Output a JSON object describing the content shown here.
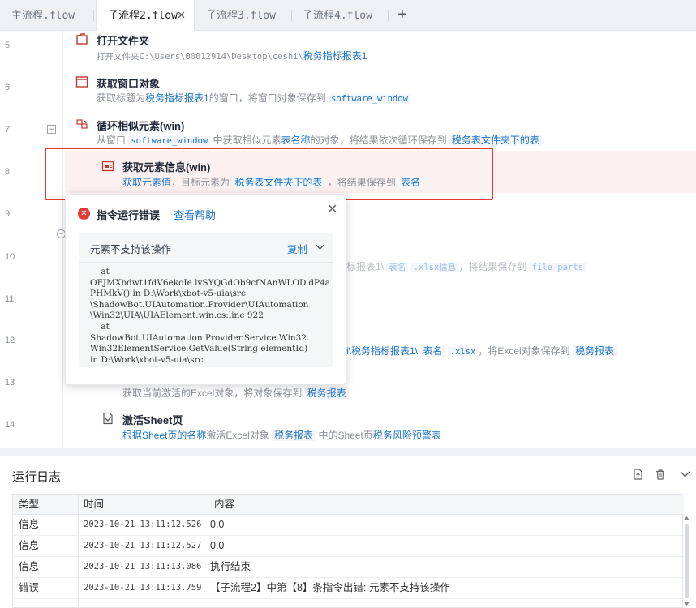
{
  "tabs": [
    {
      "label": "主流程.flow"
    },
    {
      "label": "子流程2.flow",
      "active": true
    },
    {
      "label": "子流程3.flow"
    },
    {
      "label": "子流程4.flow"
    }
  ],
  "tab_close": "✕",
  "tab_add": "+",
  "line_numbers": [
    "5",
    "6",
    "7",
    "8",
    "9",
    "10",
    "11",
    "12",
    "13",
    "14"
  ],
  "steps": {
    "s5": {
      "title": "打开文件夹",
      "desc_prefix": "打开文件夹C:\\Users\\00012914\\Desktop\\ceshi\\",
      "desc_link": "税务指标报表1"
    },
    "s6": {
      "title": "获取窗口对象",
      "desc_a": "获取标题为",
      "desc_link": "税务指标报表1",
      "desc_b": "的窗口，将窗口对象保存到",
      "var": "software_window"
    },
    "s7": {
      "title": "循环相似元素(win)",
      "desc_a": "从窗口",
      "var": "software_window",
      "desc_b": "中获取相似元素",
      "link1": "表名称",
      "desc_c": "的对象，将结果依次循环保存到",
      "link2": "税务表文件夹下的表"
    },
    "s8": {
      "title": "获取元素信息(win)",
      "link1": "获取元素值",
      "desc_a": "，目标元素为",
      "var1": "税务表文件夹下的表",
      "desc_b": "，将结果保存到",
      "var2": "表名"
    },
    "s10": {
      "frag_a": "标报表1\\",
      "var1": "表名",
      "var2": ".xlsx信息",
      "desc": "，将结果保存到",
      "var3": "file_parts"
    },
    "s12": {
      "frag_a": "i\\税务指标报表1\\",
      "var1": "表名",
      "var2": ".xlsx",
      "desc": "，将Excel对象保存到",
      "var3": "税务报表"
    },
    "s13": {
      "desc": "获取当前激活的Excel对象，将对象保存到",
      "var": "税务报表"
    },
    "s14": {
      "title": "激活Sheet页",
      "link1": "根据Sheet页的名称",
      "desc_a": "激活Excel对象",
      "var": "税务报表",
      "desc_b": "中的Sheet页",
      "link2": "税务风险预警表"
    }
  },
  "error_popup": {
    "title": "指令运行错误",
    "help": "查看帮助",
    "close": "✕",
    "message": "元素不支持该操作",
    "copy": "复制",
    "trace": "    at\nOFJMXbdwt1fdV6ekoIe.lvSYQGdOb9cfNAnWLOD.dP4agY\nPHMkV() in D:\\Work\\xbot-v5-uia\\src\n\\ShadowBot.UIAutomation.Provider\\UIAutomation\n\\Win32\\UIA\\UIAElement.win.cs:line 922\n    at\nShadowBot.UIAutomation.Provider.Service.Win32.\nWin32ElementService.GetValue(String elementId)\nin D:\\Work\\xbot-v5-uia\\src"
  },
  "log": {
    "title": "运行日志",
    "columns": [
      "类型",
      "时间",
      "内容"
    ],
    "rows": [
      {
        "type": "信息",
        "time": "2023-10-21 13:11:12.526",
        "content": "0.0"
      },
      {
        "type": "信息",
        "time": "2023-10-21 13:11:12.527",
        "content": "0.0"
      },
      {
        "type": "信息",
        "time": "2023-10-21 13:11:13.086",
        "content": "执行结束"
      },
      {
        "type": "错误",
        "time": "2023-10-21 13:11:13.759",
        "content": "【子流程2】中第【8】条指令出错: 元素不支持该操作"
      }
    ]
  },
  "colors": {
    "accent": "#1a73c8",
    "error": "#e53935",
    "error_row_bg": "#fdf0f0"
  },
  "icons": [
    "folder-open-icon",
    "window-icon",
    "loop-icon",
    "element-info-icon",
    "sheet-icon",
    "error-icon",
    "export-icon",
    "trash-icon",
    "chevron-down-icon"
  ]
}
